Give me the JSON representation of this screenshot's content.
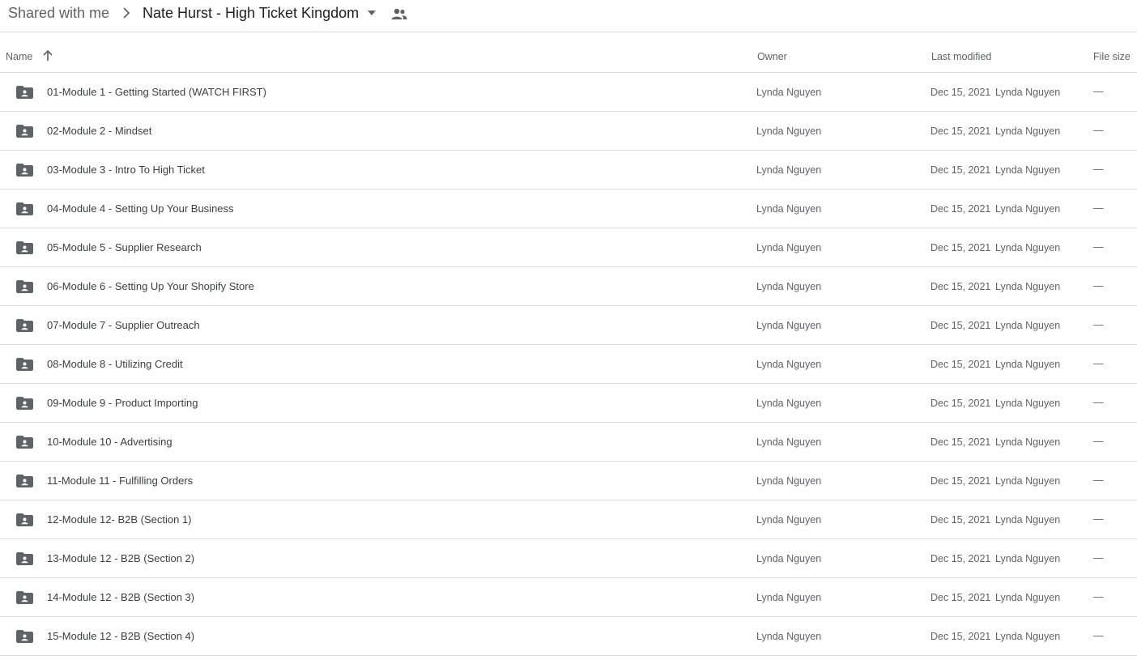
{
  "breadcrumb": {
    "parent": "Shared with me",
    "current": "Nate Hurst - High Ticket Kingdom"
  },
  "columns": {
    "name": "Name",
    "owner": "Owner",
    "last_modified": "Last modified",
    "file_size": "File size"
  },
  "sort": {
    "column": "name",
    "direction": "ascending"
  },
  "icons": {
    "separator": "chevron-right-icon",
    "dropdown": "arrow-drop-down-icon",
    "shared": "people-icon",
    "sort": "arrow-upward-icon",
    "folder": "shared-folder-icon"
  },
  "colors": {
    "icon": "#5f6368",
    "divider": "#dadce0"
  },
  "files": [
    {
      "name": "01-Module 1 - Getting Started (WATCH FIRST)",
      "owner": "Lynda Nguyen",
      "modified_date": "Dec 15, 2021",
      "modified_by": "Lynda Nguyen",
      "size": "—"
    },
    {
      "name": "02-Module 2 - Mindset",
      "owner": "Lynda Nguyen",
      "modified_date": "Dec 15, 2021",
      "modified_by": "Lynda Nguyen",
      "size": "—"
    },
    {
      "name": "03-Module 3 - Intro To High Ticket",
      "owner": "Lynda Nguyen",
      "modified_date": "Dec 15, 2021",
      "modified_by": "Lynda Nguyen",
      "size": "—"
    },
    {
      "name": "04-Module 4 - Setting Up Your Business",
      "owner": "Lynda Nguyen",
      "modified_date": "Dec 15, 2021",
      "modified_by": "Lynda Nguyen",
      "size": "—"
    },
    {
      "name": "05-Module 5 - Supplier Research",
      "owner": "Lynda Nguyen",
      "modified_date": "Dec 15, 2021",
      "modified_by": "Lynda Nguyen",
      "size": "—"
    },
    {
      "name": "06-Module 6 - Setting Up Your Shopify Store",
      "owner": "Lynda Nguyen",
      "modified_date": "Dec 15, 2021",
      "modified_by": "Lynda Nguyen",
      "size": "—"
    },
    {
      "name": "07-Module 7 - Supplier Outreach",
      "owner": "Lynda Nguyen",
      "modified_date": "Dec 15, 2021",
      "modified_by": "Lynda Nguyen",
      "size": "—"
    },
    {
      "name": "08-Module 8 - Utilizing Credit",
      "owner": "Lynda Nguyen",
      "modified_date": "Dec 15, 2021",
      "modified_by": "Lynda Nguyen",
      "size": "—"
    },
    {
      "name": "09-Module 9 - Product Importing",
      "owner": "Lynda Nguyen",
      "modified_date": "Dec 15, 2021",
      "modified_by": "Lynda Nguyen",
      "size": "—"
    },
    {
      "name": "10-Module 10 - Advertising",
      "owner": "Lynda Nguyen",
      "modified_date": "Dec 15, 2021",
      "modified_by": "Lynda Nguyen",
      "size": "—"
    },
    {
      "name": "11-Module 11 - Fulfilling Orders",
      "owner": "Lynda Nguyen",
      "modified_date": "Dec 15, 2021",
      "modified_by": "Lynda Nguyen",
      "size": "—"
    },
    {
      "name": "12-Module 12- B2B (Section 1)",
      "owner": "Lynda Nguyen",
      "modified_date": "Dec 15, 2021",
      "modified_by": "Lynda Nguyen",
      "size": "—"
    },
    {
      "name": "13-Module 12 - B2B (Section 2)",
      "owner": "Lynda Nguyen",
      "modified_date": "Dec 15, 2021",
      "modified_by": "Lynda Nguyen",
      "size": "—"
    },
    {
      "name": "14-Module 12 - B2B (Section 3)",
      "owner": "Lynda Nguyen",
      "modified_date": "Dec 15, 2021",
      "modified_by": "Lynda Nguyen",
      "size": "—"
    },
    {
      "name": "15-Module 12 - B2B (Section 4)",
      "owner": "Lynda Nguyen",
      "modified_date": "Dec 15, 2021",
      "modified_by": "Lynda Nguyen",
      "size": "—"
    }
  ]
}
